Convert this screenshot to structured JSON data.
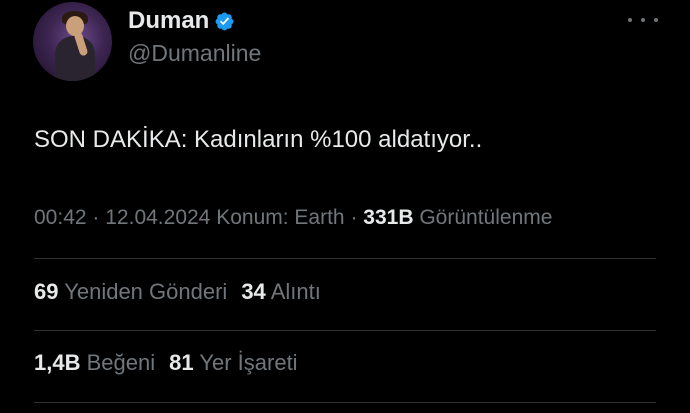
{
  "author": {
    "display_name": "Duman",
    "handle": "@Dumanline",
    "verified": true
  },
  "tweet": {
    "text": "SON DAKİKA: Kadınların %100 aldatıyor.."
  },
  "meta": {
    "time": "00:42",
    "date": "12.04.2024",
    "location": "Konum: Earth",
    "views_count": "331B",
    "views_label": "Görüntülenme",
    "separator": "·"
  },
  "stats": {
    "retweets_count": "69",
    "retweets_label": "Yeniden Gönderi",
    "quotes_count": "34",
    "quotes_label": "Alıntı",
    "likes_count": "1,4B",
    "likes_label": "Beğeni",
    "bookmarks_count": "81",
    "bookmarks_label": "Yer İşareti"
  },
  "colors": {
    "background": "#000000",
    "text_primary": "#e7e9ea",
    "text_secondary": "#71767b",
    "verified_blue": "#1d9bf0",
    "divider": "#2f3336"
  },
  "icons": {
    "verified": "verified-badge-icon",
    "more": "more-options-icon"
  }
}
